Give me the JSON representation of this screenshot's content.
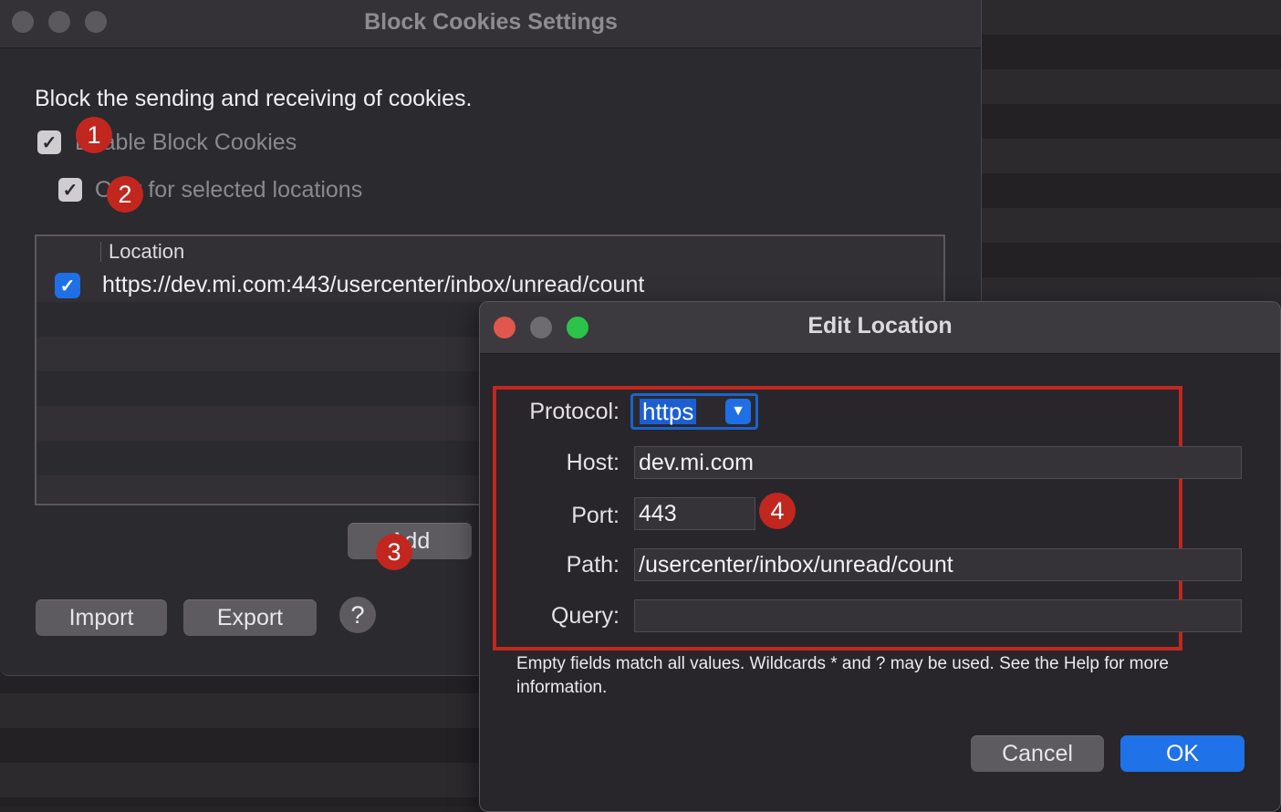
{
  "block_cookies_window": {
    "title": "Block Cookies Settings",
    "description": "Block the sending and receiving of cookies.",
    "enable_checkbox": {
      "label": "Enable Block Cookies",
      "checked": true
    },
    "only_selected_checkbox": {
      "label": "Only for selected locations",
      "checked": true
    },
    "table": {
      "column_header": "Location",
      "rows": [
        {
          "checked": true,
          "location": "https://dev.mi.com:443/usercenter/inbox/unread/count"
        }
      ]
    },
    "add_button": "Add",
    "import_button": "Import",
    "export_button": "Export",
    "help_button": "?"
  },
  "edit_location_dialog": {
    "title": "Edit Location",
    "protocol": {
      "label": "Protocol:",
      "value": "https"
    },
    "host": {
      "label": "Host:",
      "value": "dev.mi.com"
    },
    "port": {
      "label": "Port:",
      "value": "443"
    },
    "path": {
      "label": "Path:",
      "value": "/usercenter/inbox/unread/count"
    },
    "query": {
      "label": "Query:",
      "value": ""
    },
    "note": "Empty fields match all values. Wildcards * and ? may be used. See the Help for more information.",
    "cancel_button": "Cancel",
    "ok_button": "OK"
  },
  "annotations": {
    "badge_1": "1",
    "badge_2": "2",
    "badge_3": "3",
    "badge_4": "4",
    "badge_color": "#c1271e"
  },
  "colors": {
    "accent_blue": "#1f72e8",
    "close_red": "#e0574f",
    "minimize_gray": "#6e6c70",
    "zoom_green": "#2bc34a"
  }
}
